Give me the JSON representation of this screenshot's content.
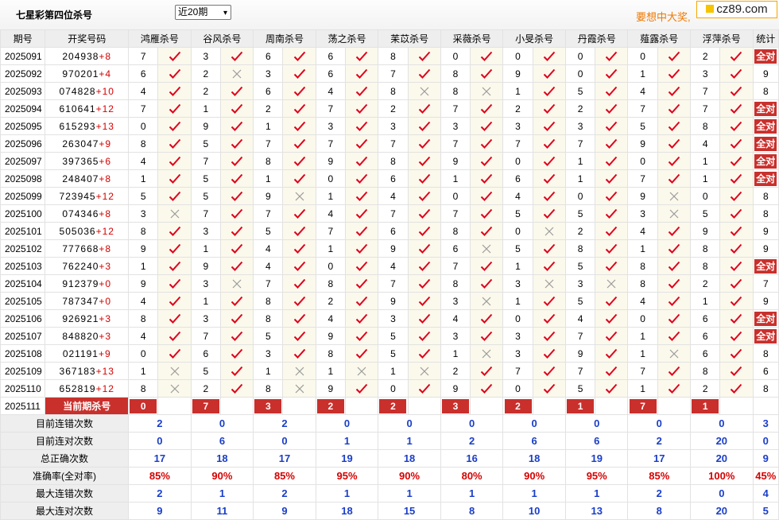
{
  "header": {
    "title": "七星彩第四位杀号",
    "period_select": "近20期",
    "promo": "要想中大奖,",
    "logo": "cz89.com"
  },
  "columns": {
    "period": "期号",
    "draw": "开奖号码",
    "experts": [
      "鸿雁杀号",
      "谷风杀号",
      "周南杀号",
      "荡之杀号",
      "苿苡杀号",
      "采薇杀号",
      "小旻杀号",
      "丹霞杀号",
      "薤露杀号",
      "浮萍杀号"
    ],
    "stat": "统计"
  },
  "rows": [
    {
      "period": "2025091",
      "draw": "204938",
      "plus": "+8",
      "kills": [
        7,
        3,
        6,
        6,
        8,
        0,
        0,
        0,
        0,
        2
      ],
      "hits": [
        1,
        1,
        1,
        1,
        1,
        1,
        1,
        1,
        1,
        1
      ],
      "stat": "全对"
    },
    {
      "period": "2025092",
      "draw": "970201",
      "plus": "+4",
      "kills": [
        6,
        2,
        3,
        6,
        7,
        8,
        9,
        0,
        1,
        3
      ],
      "hits": [
        1,
        0,
        1,
        1,
        1,
        1,
        1,
        1,
        1,
        1
      ],
      "stat": "9"
    },
    {
      "period": "2025093",
      "draw": "074828",
      "plus": "+10",
      "kills": [
        4,
        2,
        6,
        4,
        8,
        8,
        1,
        5,
        4,
        7
      ],
      "hits": [
        1,
        1,
        1,
        1,
        0,
        0,
        1,
        1,
        1,
        1
      ],
      "stat": "8"
    },
    {
      "period": "2025094",
      "draw": "610641",
      "plus": "+12",
      "kills": [
        7,
        1,
        2,
        7,
        2,
        7,
        2,
        2,
        7,
        7
      ],
      "hits": [
        1,
        1,
        1,
        1,
        1,
        1,
        1,
        1,
        1,
        1
      ],
      "stat": "全对"
    },
    {
      "period": "2025095",
      "draw": "615293",
      "plus": "+13",
      "kills": [
        0,
        9,
        1,
        3,
        3,
        3,
        3,
        3,
        5,
        8
      ],
      "hits": [
        1,
        1,
        1,
        1,
        1,
        1,
        1,
        1,
        1,
        1
      ],
      "stat": "全对"
    },
    {
      "period": "2025096",
      "draw": "263047",
      "plus": "+9",
      "kills": [
        8,
        5,
        7,
        7,
        7,
        7,
        7,
        7,
        9,
        4
      ],
      "hits": [
        1,
        1,
        1,
        1,
        1,
        1,
        1,
        1,
        1,
        1
      ],
      "stat": "全对"
    },
    {
      "period": "2025097",
      "draw": "397365",
      "plus": "+6",
      "kills": [
        4,
        7,
        8,
        9,
        8,
        9,
        0,
        1,
        0,
        1
      ],
      "hits": [
        1,
        1,
        1,
        1,
        1,
        1,
        1,
        1,
        1,
        1
      ],
      "stat": "全对"
    },
    {
      "period": "2025098",
      "draw": "248407",
      "plus": "+8",
      "kills": [
        1,
        5,
        1,
        0,
        6,
        1,
        6,
        1,
        7,
        1
      ],
      "hits": [
        1,
        1,
        1,
        1,
        1,
        1,
        1,
        1,
        1,
        1
      ],
      "stat": "全对"
    },
    {
      "period": "2025099",
      "draw": "723945",
      "plus": "+12",
      "kills": [
        5,
        5,
        9,
        1,
        4,
        0,
        4,
        0,
        9,
        0
      ],
      "hits": [
        1,
        1,
        0,
        1,
        1,
        1,
        1,
        1,
        0,
        1
      ],
      "stat": "8"
    },
    {
      "period": "2025100",
      "draw": "074346",
      "plus": "+8",
      "kills": [
        3,
        7,
        7,
        4,
        7,
        7,
        5,
        5,
        3,
        5
      ],
      "hits": [
        0,
        1,
        1,
        1,
        1,
        1,
        1,
        1,
        0,
        1
      ],
      "stat": "8"
    },
    {
      "period": "2025101",
      "draw": "505036",
      "plus": "+12",
      "kills": [
        8,
        3,
        5,
        7,
        6,
        8,
        0,
        2,
        4,
        9
      ],
      "hits": [
        1,
        1,
        1,
        1,
        1,
        1,
        0,
        1,
        1,
        1
      ],
      "stat": "9"
    },
    {
      "period": "2025102",
      "draw": "777668",
      "plus": "+8",
      "kills": [
        9,
        1,
        4,
        1,
        9,
        6,
        5,
        8,
        1,
        8
      ],
      "hits": [
        1,
        1,
        1,
        1,
        1,
        0,
        1,
        1,
        1,
        1
      ],
      "stat": "9"
    },
    {
      "period": "2025103",
      "draw": "762240",
      "plus": "+3",
      "kills": [
        1,
        9,
        4,
        0,
        4,
        7,
        1,
        5,
        8,
        8
      ],
      "hits": [
        1,
        1,
        1,
        1,
        1,
        1,
        1,
        1,
        1,
        1
      ],
      "stat": "全对"
    },
    {
      "period": "2025104",
      "draw": "912379",
      "plus": "+0",
      "kills": [
        9,
        3,
        7,
        8,
        7,
        8,
        3,
        3,
        8,
        2
      ],
      "hits": [
        1,
        0,
        1,
        1,
        1,
        1,
        0,
        0,
        1,
        1
      ],
      "stat": "7"
    },
    {
      "period": "2025105",
      "draw": "787347",
      "plus": "+0",
      "kills": [
        4,
        1,
        8,
        2,
        9,
        3,
        1,
        5,
        4,
        1
      ],
      "hits": [
        1,
        1,
        1,
        1,
        1,
        0,
        1,
        1,
        1,
        1
      ],
      "stat": "9"
    },
    {
      "period": "2025106",
      "draw": "926921",
      "plus": "+3",
      "kills": [
        8,
        3,
        8,
        4,
        3,
        4,
        0,
        4,
        0,
        6
      ],
      "hits": [
        1,
        1,
        1,
        1,
        1,
        1,
        1,
        1,
        1,
        1
      ],
      "stat": "全对"
    },
    {
      "period": "2025107",
      "draw": "848820",
      "plus": "+3",
      "kills": [
        4,
        7,
        5,
        9,
        5,
        3,
        3,
        7,
        1,
        6
      ],
      "hits": [
        1,
        1,
        1,
        1,
        1,
        1,
        1,
        1,
        1,
        1
      ],
      "stat": "全对"
    },
    {
      "period": "2025108",
      "draw": "021191",
      "plus": "+9",
      "kills": [
        0,
        6,
        3,
        8,
        5,
        1,
        3,
        9,
        1,
        6
      ],
      "hits": [
        1,
        1,
        1,
        1,
        1,
        0,
        1,
        1,
        0,
        1
      ],
      "stat": "8"
    },
    {
      "period": "2025109",
      "draw": "367183",
      "plus": "+13",
      "kills": [
        1,
        5,
        1,
        1,
        1,
        2,
        7,
        7,
        7,
        8
      ],
      "hits": [
        0,
        1,
        0,
        0,
        0,
        1,
        1,
        1,
        1,
        1
      ],
      "stat": "6"
    },
    {
      "period": "2025110",
      "draw": "652819",
      "plus": "+12",
      "kills": [
        8,
        2,
        8,
        9,
        0,
        9,
        0,
        5,
        1,
        2
      ],
      "hits": [
        0,
        1,
        0,
        1,
        1,
        1,
        1,
        1,
        1,
        1
      ],
      "stat": "8"
    }
  ],
  "current": {
    "period": "2025111",
    "label": "当前期杀号",
    "kills": [
      "0",
      "7",
      "3",
      "2",
      "2",
      "3",
      "2",
      "1",
      "7",
      "1"
    ]
  },
  "summary": [
    {
      "label": "目前连错次数",
      "values": [
        "2",
        "0",
        "2",
        "0",
        "0",
        "0",
        "0",
        "0",
        "0",
        "0"
      ],
      "stat": "3",
      "red": false
    },
    {
      "label": "目前连对次数",
      "values": [
        "0",
        "6",
        "0",
        "1",
        "1",
        "2",
        "6",
        "6",
        "2",
        "20"
      ],
      "stat": "0",
      "red": false
    },
    {
      "label": "总正确次数",
      "values": [
        "17",
        "18",
        "17",
        "19",
        "18",
        "16",
        "18",
        "19",
        "17",
        "20"
      ],
      "stat": "9",
      "red": false
    },
    {
      "label": "准确率(全对率)",
      "values": [
        "85%",
        "90%",
        "85%",
        "95%",
        "90%",
        "80%",
        "90%",
        "95%",
        "85%",
        "100%"
      ],
      "stat": "45%",
      "red": true
    },
    {
      "label": "最大连错次数",
      "values": [
        "2",
        "1",
        "2",
        "1",
        "1",
        "1",
        "1",
        "1",
        "2",
        "0"
      ],
      "stat": "4",
      "red": false
    },
    {
      "label": "最大连对次数",
      "values": [
        "9",
        "11",
        "9",
        "18",
        "15",
        "8",
        "10",
        "13",
        "8",
        "20"
      ],
      "stat": "5",
      "red": false
    }
  ],
  "colors": {
    "check": "#e0001b",
    "cross": "#9a9a9a",
    "highlight": "#c9302c",
    "accent_blue": "#1a3ec8"
  },
  "icons": {
    "hit": "check-icon",
    "miss": "cross-icon"
  }
}
